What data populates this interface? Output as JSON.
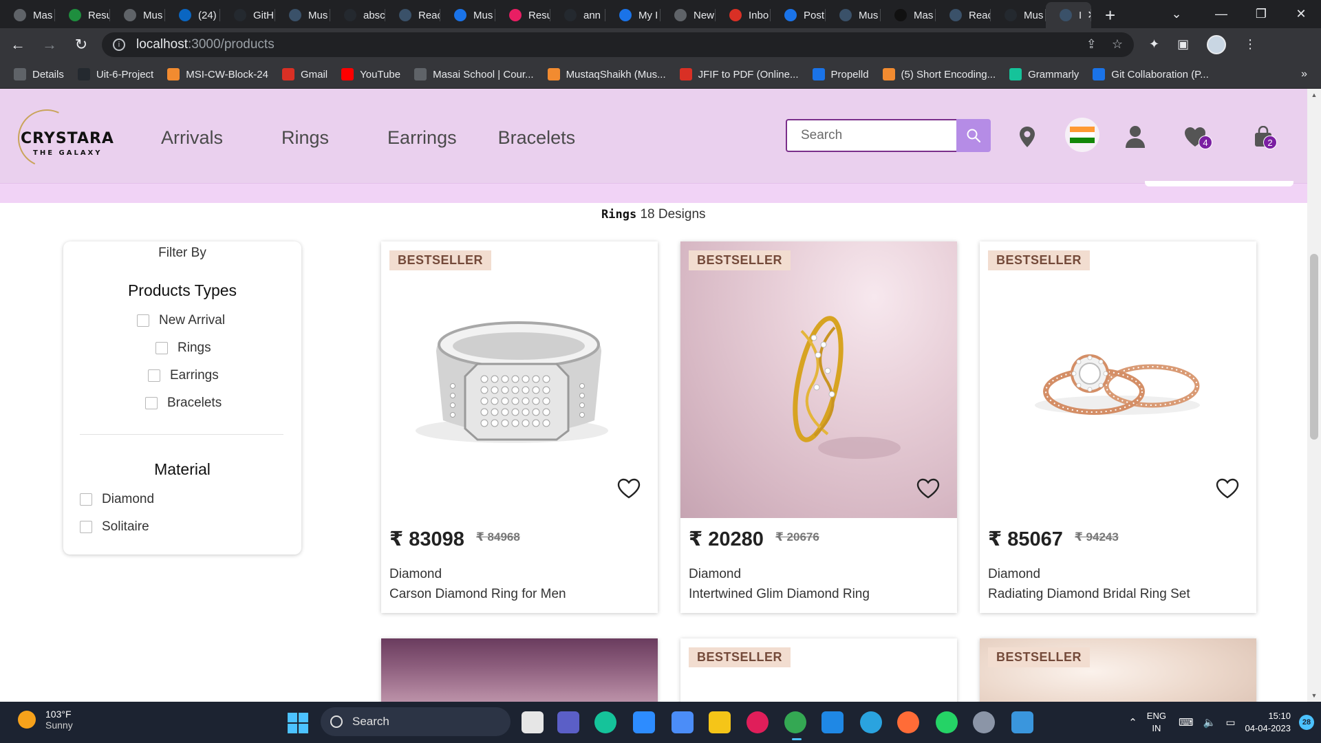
{
  "browser": {
    "tabs": [
      {
        "label": "Mas",
        "icon": "chrome-icon",
        "color": "#5f6368"
      },
      {
        "label": "Resu",
        "icon": "sheets-icon",
        "color": "#1e8e3e"
      },
      {
        "label": "Mus",
        "icon": "chrome-icon",
        "color": "#5f6368"
      },
      {
        "label": "(24)",
        "icon": "linkedin-icon",
        "color": "#0a66c2"
      },
      {
        "label": "GitH",
        "icon": "github-icon",
        "color": "#24292f"
      },
      {
        "label": "Mus",
        "icon": "react-icon",
        "color": "#3a5169"
      },
      {
        "label": "absc",
        "icon": "github-icon",
        "color": "#24292f"
      },
      {
        "label": "Reac",
        "icon": "react-icon",
        "color": "#3a5169"
      },
      {
        "label": "Mus",
        "icon": "drive-icon",
        "color": "#1a73e8"
      },
      {
        "label": "Resu",
        "icon": "resume-icon",
        "color": "#e91e63"
      },
      {
        "label": "ann",
        "icon": "github-icon",
        "color": "#24292f"
      },
      {
        "label": "My I",
        "icon": "drive-icon",
        "color": "#1a73e8"
      },
      {
        "label": "New",
        "icon": "chrome-icon",
        "color": "#5f6368"
      },
      {
        "label": "Inbo",
        "icon": "gmail-icon",
        "color": "#d93025"
      },
      {
        "label": "Post",
        "icon": "zoho-icon",
        "color": "#1a73e8"
      },
      {
        "label": "Mus",
        "icon": "react-icon",
        "color": "#3a5169"
      },
      {
        "label": "Mas",
        "icon": "masai-icon",
        "color": "#111111"
      },
      {
        "label": "Reac",
        "icon": "react-icon",
        "color": "#3a5169"
      },
      {
        "label": "Mus",
        "icon": "github-icon",
        "color": "#24292f"
      },
      {
        "label": "I",
        "icon": "react-icon",
        "color": "#3a5169",
        "active": true
      }
    ],
    "new_tab": "+",
    "url_host": "localhost",
    "url_path": ":3000/products",
    "bookmarks": [
      {
        "label": "Details",
        "color": "#5f6368"
      },
      {
        "label": "Uit-6-Project",
        "color": "#24292f"
      },
      {
        "label": "MSI-CW-Block-24",
        "color": "#f28b30"
      },
      {
        "label": "Gmail",
        "color": "#d93025"
      },
      {
        "label": "YouTube",
        "color": "#ff0000"
      },
      {
        "label": "Masai School | Cour...",
        "color": "#5f6368"
      },
      {
        "label": "MustaqShaikh (Mus...",
        "color": "#f28b30"
      },
      {
        "label": "JFIF to PDF (Online...",
        "color": "#d93025"
      },
      {
        "label": "Propelld",
        "color": "#1a73e8"
      },
      {
        "label": "(5) Short Encoding...",
        "color": "#f28b30"
      },
      {
        "label": "Grammarly",
        "color": "#15c39a"
      },
      {
        "label": "Git Collaboration (P...",
        "color": "#1a73e8"
      }
    ],
    "bookmarks_more": "»"
  },
  "site": {
    "logo_name": "CRYSTARA",
    "logo_tagline": "THE GALAXY",
    "nav": [
      "Arrivals",
      "Rings",
      "Earrings",
      "Bracelets"
    ],
    "search_placeholder": "Search",
    "wishlist_count": "4",
    "cart_count": "2",
    "results_keyword": "Rings",
    "results_count": "18 Designs"
  },
  "filter": {
    "title": "Filter By",
    "product_types_heading": "Products Types",
    "product_types": [
      "New Arrival",
      "Rings",
      "Earrings",
      "Bracelets"
    ],
    "material_heading": "Material",
    "materials": [
      "Diamond",
      "Solitaire"
    ]
  },
  "products": [
    {
      "tag": "BESTSELLER",
      "price": "₹ 83098",
      "mrp": "₹ 84968",
      "metal": "Diamond",
      "name": "Carson Diamond Ring for Men"
    },
    {
      "tag": "BESTSELLER",
      "price": "₹ 20280",
      "mrp": "₹ 20676",
      "metal": "Diamond",
      "name": "Intertwined Glim Diamond Ring"
    },
    {
      "tag": "BESTSELLER",
      "price": "₹ 85067",
      "mrp": "₹ 94243",
      "metal": "Diamond",
      "name": "Radiating Diamond Bridal Ring Set"
    }
  ],
  "products_row2": [
    {
      "tag": ""
    },
    {
      "tag": "BESTSELLER"
    },
    {
      "tag": "BESTSELLER"
    }
  ],
  "taskbar": {
    "temperature": "103°F",
    "condition": "Sunny",
    "search_label": "Search",
    "lang_line1": "ENG",
    "lang_line2": "IN",
    "time": "15:10",
    "date": "04-04-2023",
    "notifications": "28"
  },
  "colors": {
    "header_bg": "#ead0ee",
    "accent_purple": "#7b1fa2",
    "search_button": "#b58ce6",
    "tag_bg": "#f2ddd0"
  }
}
